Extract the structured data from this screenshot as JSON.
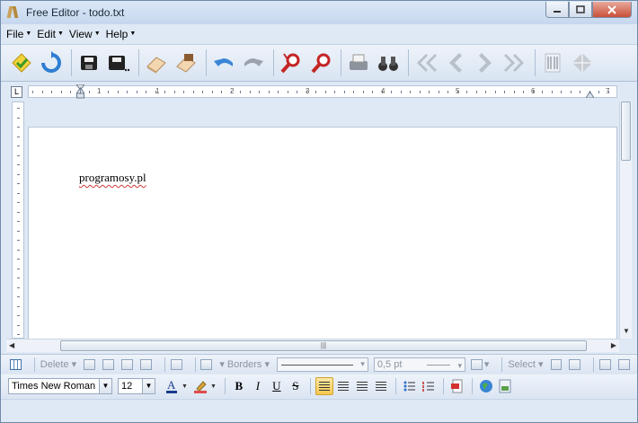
{
  "window": {
    "title": "Free Editor - todo.txt"
  },
  "menu": [
    {
      "label": "File"
    },
    {
      "label": "Edit"
    },
    {
      "label": "View"
    },
    {
      "label": "Help"
    }
  ],
  "toolbar_icons": [
    "new-document-icon",
    "reload-icon",
    "save-icon",
    "save-as-icon",
    "eraser-icon",
    "paste-icon",
    "undo-icon",
    "redo-icon",
    "find-icon",
    "replace-icon",
    "print-icon",
    "binoculars-icon",
    "first-icon",
    "previous-icon",
    "next-icon",
    "last-icon",
    "barcode-icon",
    "diamond-icon"
  ],
  "ruler": {
    "marks": [
      "1",
      "1",
      "2",
      "3",
      "4",
      "5",
      "6",
      "7"
    ]
  },
  "document": {
    "text": "programosy.pl"
  },
  "table_toolbar": {
    "delete_label": "Delete",
    "borders_label": "Borders",
    "line_width": "0,5 pt",
    "select_label": "Select"
  },
  "format_toolbar": {
    "font": "Times New Roman",
    "size": "12",
    "bold": "B",
    "italic": "I",
    "underline": "U",
    "strike": "S"
  },
  "colors": {
    "accent": "#3f6faa",
    "chrome": "#dfe9f5",
    "active_button": "#f7c84f"
  }
}
